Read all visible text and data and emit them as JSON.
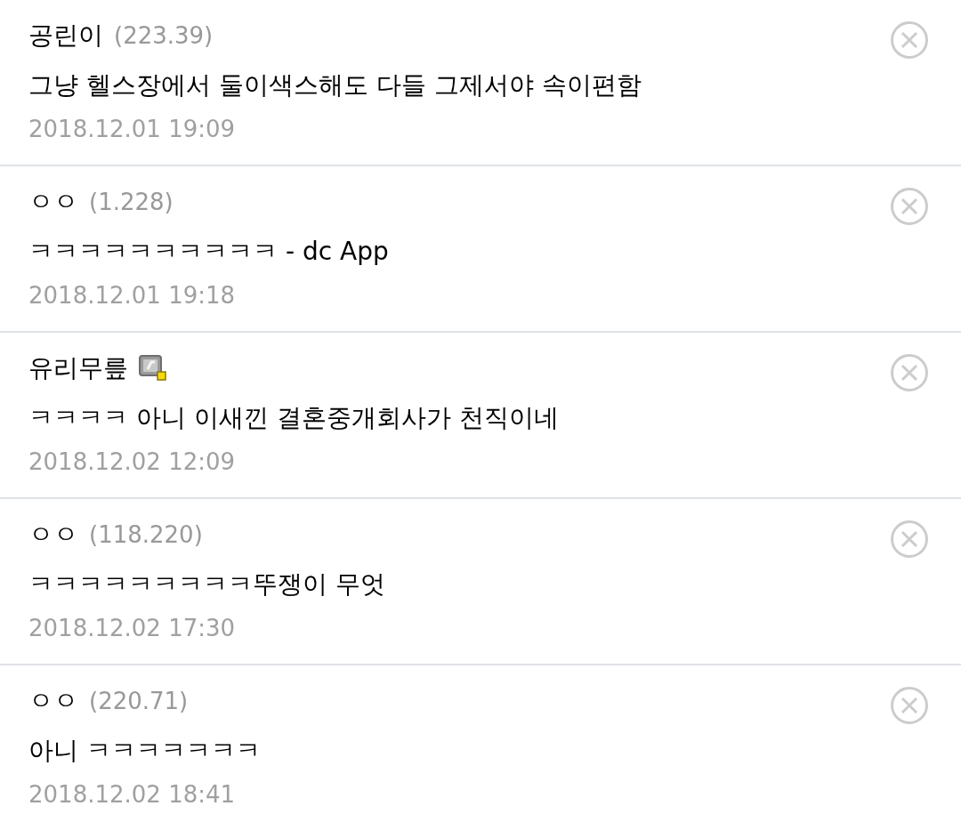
{
  "comments": [
    {
      "author": "공린이",
      "ip": "(223.39)",
      "fixed_nick": false,
      "text": "그냥 헬스장에서 둘이색스해도 다들 그제서야 속이편함",
      "date": "2018.12.01 19:09"
    },
    {
      "author": "ㅇㅇ",
      "ip": "(1.228)",
      "fixed_nick": false,
      "text": "ㅋㅋㅋㅋㅋㅋㅋㅋㅋㅋ - dc App",
      "date": "2018.12.01 19:18"
    },
    {
      "author": "유리무릎",
      "fixed_nick": true,
      "text": "ㅋㅋㅋㅋ 아니 이새낀 결혼중개회사가 천직이네",
      "date": "2018.12.02 12:09"
    },
    {
      "author": "ㅇㅇ",
      "ip": "(118.220)",
      "fixed_nick": false,
      "text": "ㅋㅋㅋㅋㅋㅋㅋㅋㅋ뚜쟁이 무엇",
      "date": "2018.12.02 17:30"
    },
    {
      "author": "ㅇㅇ",
      "ip": "(220.71)",
      "fixed_nick": false,
      "text": "아니 ㅋㅋㅋㅋㅋㅋㅋ",
      "date": "2018.12.02 18:41"
    }
  ]
}
